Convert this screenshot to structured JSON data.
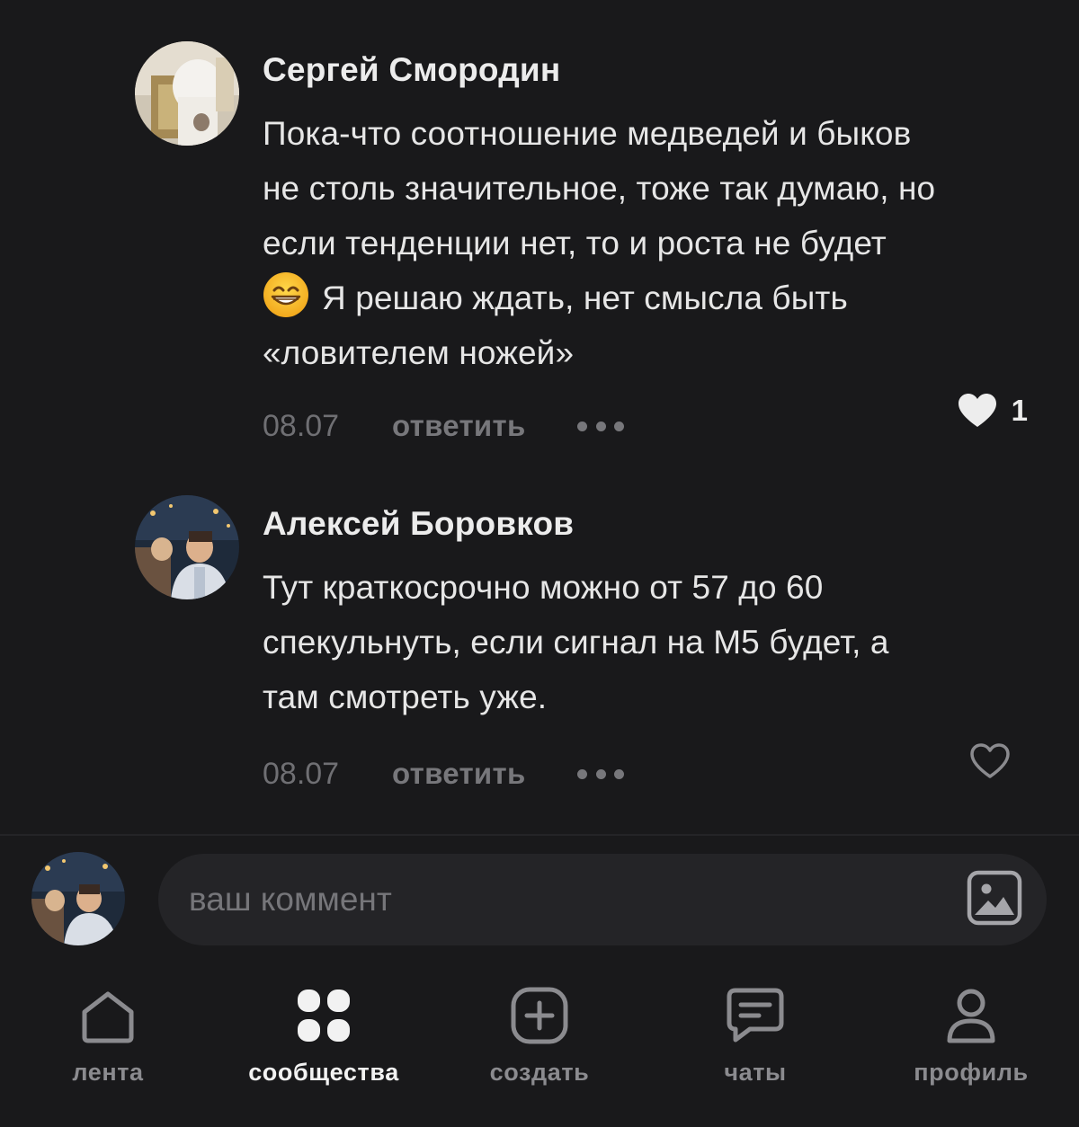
{
  "comments": [
    {
      "author": "Сергей Смородин",
      "text_lines": [
        "Пока-что соотношение медведей и быков",
        "не столь значительное, тоже так думаю, но",
        "если тенденции нет, то и роста не будет",
        "Я решаю ждать, нет смысла быть",
        "«ловителем ножей»"
      ],
      "emoji": "grinning-face-emoji",
      "date": "08.07",
      "reply_label": "ответить",
      "like_count": "1",
      "liked": true
    },
    {
      "author": "Алексей Боровков",
      "text_lines": [
        "Тут краткосрочно можно от 57 до 60",
        "спекульнуть, если сигнал на М5 будет, а",
        "там смотреть уже."
      ],
      "date": "08.07",
      "reply_label": "ответить",
      "like_count": "",
      "liked": false
    }
  ],
  "composer": {
    "placeholder": "ваш коммент",
    "value": "",
    "attach_icon": "image-icon"
  },
  "nav": {
    "items": [
      {
        "label": "лента",
        "icon": "home-icon",
        "active": false
      },
      {
        "label": "сообщества",
        "icon": "communities-icon",
        "active": true
      },
      {
        "label": "создать",
        "icon": "create-icon",
        "active": false
      },
      {
        "label": "чаты",
        "icon": "chat-icon",
        "active": false
      },
      {
        "label": "профиль",
        "icon": "profile-icon",
        "active": false
      }
    ]
  },
  "colors": {
    "background": "#19191b",
    "input_background": "#242427",
    "text": "#ebebeb",
    "muted": "#77777b",
    "active_nav": "#f2f2f2"
  }
}
